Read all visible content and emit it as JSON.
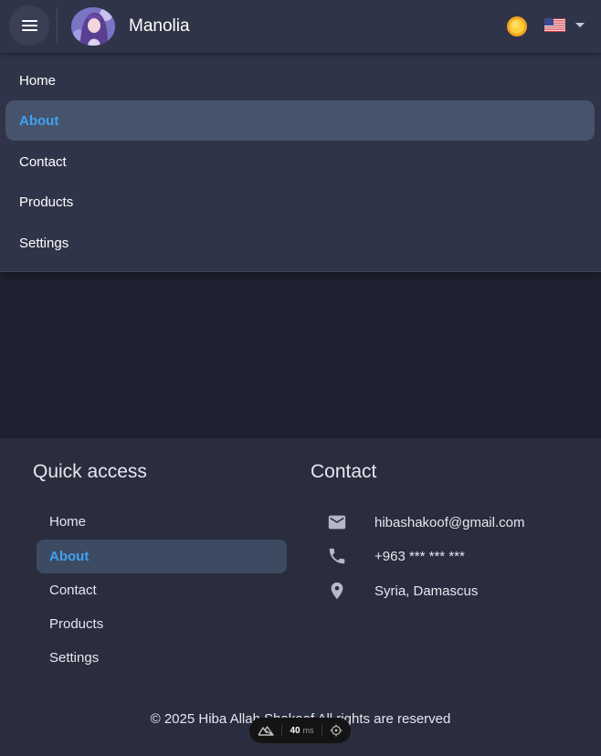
{
  "header": {
    "brand": "Manolia",
    "language": "en-US"
  },
  "drawer": {
    "items": [
      {
        "label": "Home",
        "active": false
      },
      {
        "label": "About",
        "active": true
      },
      {
        "label": "Contact",
        "active": false
      },
      {
        "label": "Products",
        "active": false
      },
      {
        "label": "Settings",
        "active": false
      }
    ]
  },
  "footer": {
    "quick_access_title": "Quick access",
    "quick_access_items": [
      {
        "label": "Home",
        "active": false
      },
      {
        "label": "About",
        "active": true
      },
      {
        "label": "Contact",
        "active": false
      },
      {
        "label": "Products",
        "active": false
      },
      {
        "label": "Settings",
        "active": false
      }
    ],
    "contact_title": "Contact",
    "contact": {
      "email": "hibashakoof@gmail.com",
      "phone": "+963 *** *** ***",
      "location": "Syria, Damascus"
    },
    "copyright": "© 2025 Hiba Allah Shakoof All rights are reserved"
  },
  "devtools": {
    "render_time_value": "40",
    "render_time_unit": "ms"
  },
  "colors": {
    "accent": "#42a0f2",
    "header_bg": "#303448",
    "footer_bg": "#2a2d3d",
    "active_item_bg": "#46536c",
    "page_bg": "#1e2130"
  },
  "icons": {
    "menu": "menu-icon",
    "theme": "sun-icon",
    "language": "us-flag-icon",
    "email": "mail-icon",
    "phone": "phone-icon",
    "location": "location-pin-icon"
  }
}
